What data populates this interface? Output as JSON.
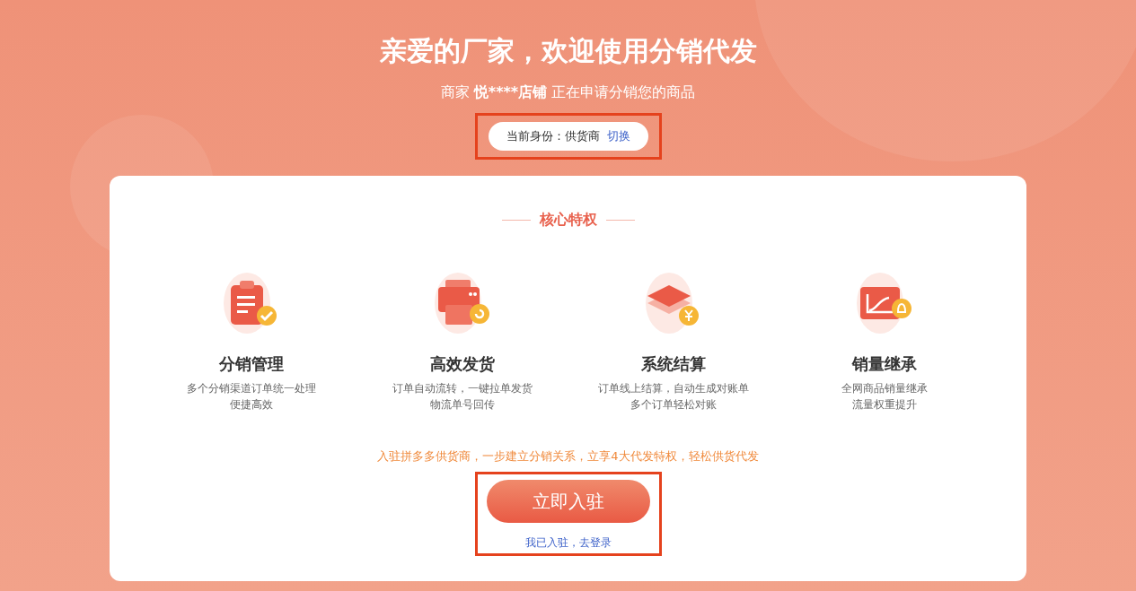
{
  "header": {
    "title": "亲爱的厂家，欢迎使用分销代发",
    "subtitle": {
      "prefix": "商家",
      "shop": "悦****店铺",
      "suffix": "正在申请分销您的商品"
    },
    "identity": {
      "label": "当前身份：供货商",
      "switch_link": "切换"
    }
  },
  "card": {
    "heading": "核心特权",
    "features": [
      {
        "kind": "clipboard",
        "title": "分销管理",
        "lines": [
          "多个分销渠道订单统一处理",
          "便捷高效"
        ]
      },
      {
        "kind": "printer",
        "title": "高效发货",
        "lines": [
          "订单自动流转，一键拉单发货",
          "物流单号回传"
        ]
      },
      {
        "kind": "stack",
        "title": "系统结算",
        "lines": [
          "订单线上结算，自动生成对账单",
          "多个订单轻松对账"
        ]
      },
      {
        "kind": "chart",
        "title": "销量继承",
        "lines": [
          "全网商品销量继承",
          "流量权重提升"
        ]
      }
    ],
    "promo": "入驻拼多多供货商，一步建立分销关系，立享4大代发特权，轻松供货代发",
    "join_button": "立即入驻",
    "login_link": "我已入驻，去登录"
  }
}
